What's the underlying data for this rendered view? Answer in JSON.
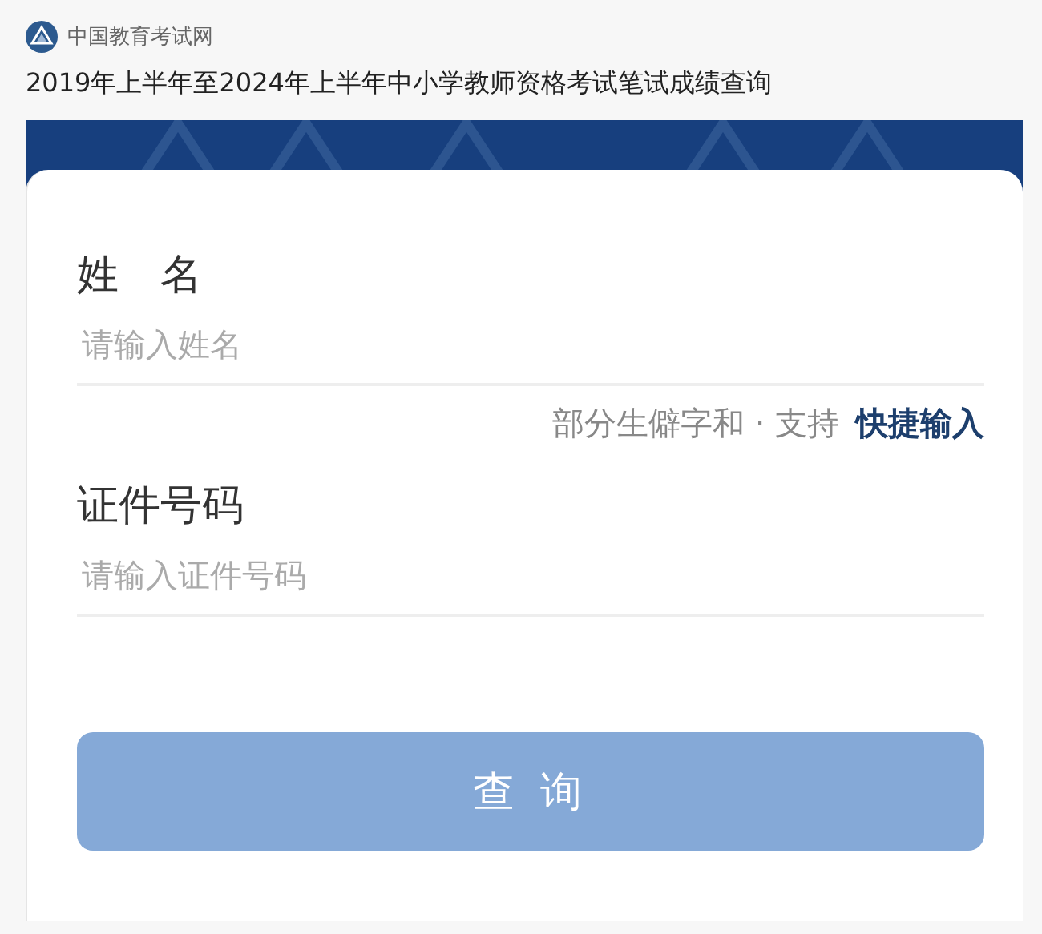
{
  "site": {
    "name": "中国教育考试网"
  },
  "page_title": "2019年上半年至2024年上半年中小学教师资格考试笔试成绩查询",
  "fields": [
    {
      "label": "姓　名",
      "placeholder": "请输入姓名"
    },
    {
      "label": "证件号码",
      "placeholder": "请输入证件号码"
    }
  ],
  "hint": {
    "text": "部分生僻字和 · 支持",
    "link": "快捷输入"
  },
  "submit": {
    "label": "查 询",
    "disabled": true
  }
}
